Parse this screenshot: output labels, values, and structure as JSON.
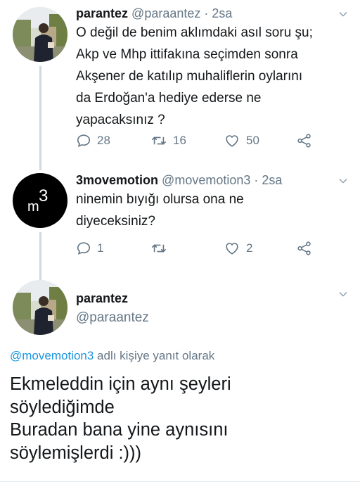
{
  "tweets": [
    {
      "name": "parantez",
      "handle": "@paraantez",
      "time": " · 2sa",
      "lines": [
        "O değil de benim aklımdaki asıl soru şu;",
        "Akp ve Mhp ittifakına seçimden sonra",
        "Akşener de katılıp muhaliflerin oylarını",
        "da Erdoğan'a hediye ederse ne",
        "yapacaksınız ?"
      ],
      "replies": "28",
      "retweets": "16",
      "likes": "50"
    },
    {
      "name": "3movemotion",
      "handle": "@movemotion3",
      "time": " · 2sa",
      "avatar_text": {
        "m": "m",
        "sup": "3"
      },
      "lines": [
        "ninemin bıyığı olursa ona ne",
        "diyeceksiniz?"
      ],
      "replies": "1",
      "retweets": "",
      "likes": "2"
    }
  ],
  "main_tweet": {
    "name": "parantez",
    "handle": "@paraantez",
    "reply_to_handle": "@movemotion3",
    "reply_to_suffix": " adlı kişiye yanıt olarak",
    "lines": [
      "Ekmeleddin için aynı şeyleri",
      "söylediğimde",
      "Buradan bana yine aynısını",
      "söylemişlerdi :)))"
    ]
  },
  "icons": [
    "reply-icon",
    "retweet-icon",
    "like-icon",
    "share-icon",
    "chevron-down-icon"
  ],
  "colors": {
    "text": "#14171a",
    "muted": "#657786",
    "link": "#1b95e0",
    "thread": "#cfd9de"
  }
}
